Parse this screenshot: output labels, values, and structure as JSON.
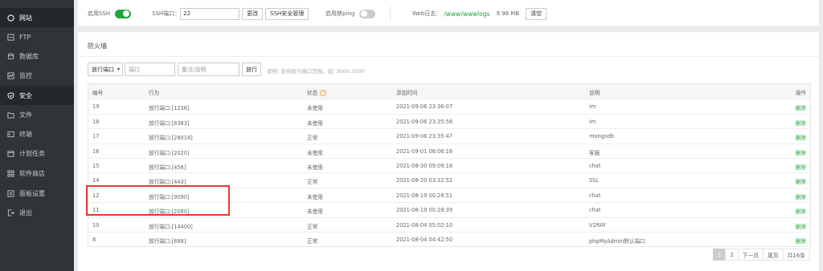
{
  "sidebar": {
    "items": [
      {
        "label": "网站",
        "icon": "globe-icon",
        "active": true
      },
      {
        "label": "FTP",
        "icon": "ftp-icon"
      },
      {
        "label": "数据库",
        "icon": "database-icon"
      },
      {
        "label": "监控",
        "icon": "monitor-icon"
      },
      {
        "label": "安全",
        "icon": "shield-icon",
        "active": true
      },
      {
        "label": "文件",
        "icon": "folder-icon"
      },
      {
        "label": "终端",
        "icon": "terminal-icon"
      },
      {
        "label": "计划任务",
        "icon": "calendar-icon"
      },
      {
        "label": "软件商店",
        "icon": "grid-icon"
      },
      {
        "label": "面板设置",
        "icon": "settings-icon"
      },
      {
        "label": "退出",
        "icon": "logout-icon"
      }
    ]
  },
  "toolbar": {
    "ssh_label": "启用SSH",
    "port_label": "SSH端口：",
    "port_value": "22",
    "change_btn": "更改",
    "ssh_manage_btn": "SSH安全管理",
    "ping_label": "启用禁ping",
    "log_label": "Web日志：",
    "log_path": "/www/wwwlogs",
    "log_size": "9.98 MB",
    "clear_btn": "清空"
  },
  "firewall": {
    "title": "防火墙",
    "select_value": "放行端口",
    "port_placeholder": "端口",
    "note_placeholder": "备注/说明",
    "allow_btn": "放行",
    "hint": "说明: 支持放行端口范围，如: 3000:3500",
    "columns": [
      "编号",
      "行为",
      "状态",
      "添加时间",
      "说明",
      "操作"
    ],
    "rows": [
      {
        "id": "19",
        "action": "放行端口:[1236]",
        "status": "未使用",
        "time": "2021-09-06 23:36:07",
        "note": "im",
        "op": "删除"
      },
      {
        "id": "18",
        "action": "放行端口:[8383]",
        "status": "未使用",
        "time": "2021-09-06 23:35:56",
        "note": "im",
        "op": "删除"
      },
      {
        "id": "17",
        "action": "放行端口:[28018]",
        "status": "正常",
        "time": "2021-09-06 23:35:47",
        "note": "mongodb",
        "op": "删除"
      },
      {
        "id": "16",
        "action": "放行端口:[2020]",
        "status": "未使用",
        "time": "2021-09-01 06:06:16",
        "note": "客服",
        "op": "删除"
      },
      {
        "id": "15",
        "action": "放行端口:[456]",
        "status": "未使用",
        "time": "2021-08-30 09:09:16",
        "note": "chat",
        "op": "删除"
      },
      {
        "id": "14",
        "action": "放行端口:[443]",
        "status": "正常",
        "time": "2021-08-20 03:32:52",
        "note": "SSL",
        "op": "删除"
      },
      {
        "id": "12",
        "action": "放行端口:[9090]",
        "status": "未使用",
        "time": "2021-08-19 00:28:51",
        "note": "chat",
        "op": "删除"
      },
      {
        "id": "11",
        "action": "放行端口:[2080]",
        "status": "未使用",
        "time": "2021-08-19 00:28:39",
        "note": "chat",
        "op": "删除"
      },
      {
        "id": "10",
        "action": "放行端口:[14400]",
        "status": "正常",
        "time": "2021-08-04 05:02:10",
        "note": "V2RAY",
        "op": "删除"
      },
      {
        "id": "8",
        "action": "放行端口:[888]",
        "status": "正常",
        "time": "2021-08-04 04:42:50",
        "note": "phpMyAdmin默认端口",
        "op": "删除"
      }
    ],
    "pager": [
      "1",
      "2",
      "下一页",
      "尾页",
      "共16条"
    ]
  },
  "colors": {
    "accent": "#20a53a",
    "highlight": "#e53935",
    "sidebar": "#2f3437"
  }
}
